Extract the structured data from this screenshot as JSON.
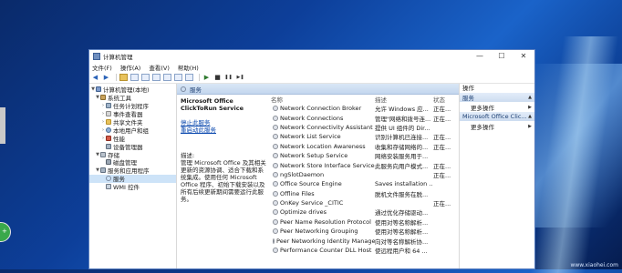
{
  "window": {
    "title": "计算机管理",
    "controls": {
      "minimize": "—",
      "maximize": "☐",
      "close": "✕"
    }
  },
  "menu": [
    "文件(F)",
    "操作(A)",
    "查看(V)",
    "帮助(H)"
  ],
  "toolbar": {
    "icons": [
      "back-icon",
      "forward-icon",
      "up-folder-icon",
      "show-tree-icon",
      "properties-icon",
      "refresh-icon",
      "export-icon",
      "help-icon",
      "view-icon",
      "play-icon",
      "stop-icon",
      "pause-icon",
      "restart-icon"
    ],
    "glyphs": {
      "back": "◀",
      "forward": "▶",
      "play": "▶",
      "stop": "■",
      "pause": "❚❚",
      "restart": "▶❚"
    }
  },
  "tree": {
    "root": "计算机管理(本地)",
    "items": [
      {
        "label": "系统工具",
        "level": 1,
        "expanded": true
      },
      {
        "label": "任务计划程序",
        "level": 2
      },
      {
        "label": "事件查看器",
        "level": 2
      },
      {
        "label": "共享文件夹",
        "level": 2
      },
      {
        "label": "本地用户和组",
        "level": 2
      },
      {
        "label": "性能",
        "level": 2
      },
      {
        "label": "设备管理器",
        "level": 2
      },
      {
        "label": "存储",
        "level": 1,
        "expanded": true
      },
      {
        "label": "磁盘管理",
        "level": 2
      },
      {
        "label": "服务和应用程序",
        "level": 1,
        "expanded": true
      },
      {
        "label": "服务",
        "level": 2,
        "selected": true
      },
      {
        "label": "WMI 控件",
        "level": 2
      }
    ]
  },
  "services_pane": {
    "header": "服务",
    "selected_service": "Microsoft Office ClickToRun Service",
    "links": {
      "stop": "停止此服务",
      "restart": "重启动此服务"
    },
    "description_label": "描述:",
    "description": "管理 Microsoft Office 及其相关更新的资源协调、适合下载和系统集成。使用任何 Microsoft Office 程序、初始下载安装以及所有后续更新期间需要运行此服务。",
    "columns": {
      "name": "名称",
      "description": "描述",
      "status": "状态"
    },
    "rows": [
      {
        "name": "Network Connection Broker",
        "description": "允许 Windows 应...",
        "status": "正在..."
      },
      {
        "name": "Network Connections",
        "description": "管理\"网络和拨号连...",
        "status": "正在..."
      },
      {
        "name": "Network Connectivity Assistant",
        "description": "提供 UI 组件的 Dir...",
        "status": ""
      },
      {
        "name": "Network List Service",
        "description": "识别计算机已连接...",
        "status": "正在..."
      },
      {
        "name": "Network Location Awareness",
        "description": "收集和存储网络的...",
        "status": "正在..."
      },
      {
        "name": "Network Setup Service",
        "description": "网络安装服务用于...",
        "status": ""
      },
      {
        "name": "Network Store Interface Service",
        "description": "此服务向用户模式...",
        "status": "正在..."
      },
      {
        "name": "ngSlotDaemon",
        "description": "",
        "status": "正在..."
      },
      {
        "name": "Office  Source Engine",
        "description": "Saves installation ...",
        "status": ""
      },
      {
        "name": "Offline Files",
        "description": "脱机文件服务在脱...",
        "status": ""
      },
      {
        "name": "OnKey Service _CITIC",
        "description": "",
        "status": "正在..."
      },
      {
        "name": "Optimize drives",
        "description": "通过优化存储驱动...",
        "status": ""
      },
      {
        "name": "Peer Name Resolution Protocol",
        "description": "使用对等名称解析...",
        "status": ""
      },
      {
        "name": "Peer Networking Grouping",
        "description": "使用对等名称解析...",
        "status": ""
      },
      {
        "name": "Peer Networking Identity Manager",
        "description": "向对等名称解析协...",
        "status": ""
      },
      {
        "name": "Performance Counter DLL Host",
        "description": "使远程用户和 64 ...",
        "status": ""
      }
    ]
  },
  "actions": {
    "title": "操作",
    "sections": [
      {
        "label": "服务",
        "items": [
          "更多操作"
        ]
      },
      {
        "label": "Microsoft Office Clic...",
        "items": [
          "更多操作"
        ]
      }
    ]
  },
  "desktop": {
    "badge": "+",
    "corner_text": "www.xiaohei.com"
  },
  "colors": {
    "desktop_blue": "#0d3f9a",
    "window_border": "#5b7fbf",
    "selection": "#cde3f8",
    "link": "#0645ad"
  }
}
